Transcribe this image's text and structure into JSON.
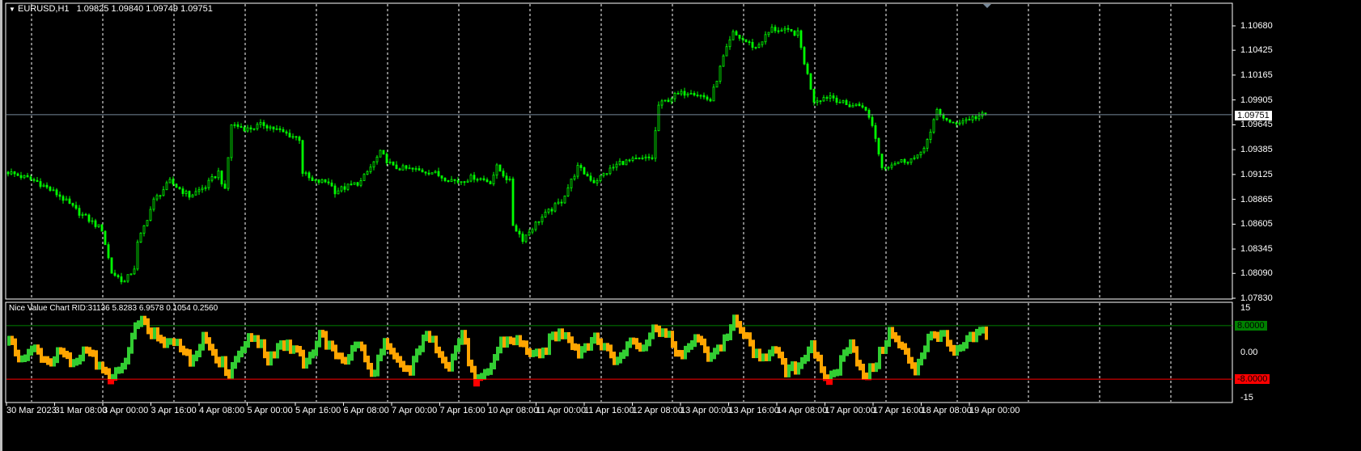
{
  "header": {
    "symbol": "EURUSD,H1",
    "ohlc": "1.09825 1.09840 1.09749 1.09751"
  },
  "indicator": {
    "label": "Nice Value Chart RID:31136 5.8283 6.9578 0.1054 0.2560",
    "axis": [
      "15",
      "0.00",
      "-15"
    ],
    "upper_level": "8.0000",
    "lower_level": "-8.0000",
    "upper_value": 8,
    "lower_value": -8,
    "range": [
      -15,
      15
    ],
    "values": [
      3,
      -2,
      1,
      -3,
      0,
      -4,
      2,
      -5,
      -8,
      -3,
      10,
      6,
      2,
      4,
      -3,
      5,
      -1,
      -6,
      2,
      5,
      -2,
      3,
      1,
      -4,
      6,
      0,
      -2,
      3,
      -7,
      2,
      -3,
      -6,
      5,
      2,
      -4,
      6,
      -10,
      -6,
      3,
      4,
      1,
      -2,
      5,
      6,
      0,
      4,
      2,
      -3,
      4,
      2,
      8,
      4,
      -2,
      5,
      -1,
      2,
      9,
      4,
      -3,
      2,
      -6,
      -4,
      3,
      -9,
      -5,
      4,
      -8,
      -3,
      6,
      1,
      -5,
      4,
      6,
      -1,
      3,
      6
    ]
  },
  "price_axis": [
    "1.10680",
    "1.10425",
    "1.10165",
    "1.09905",
    "1.09645",
    "1.09385",
    "1.09125",
    "1.08865",
    "1.08605",
    "1.08345",
    "1.08090",
    "1.07830"
  ],
  "current_price": "1.09751",
  "price_range": [
    1.0783,
    1.1068
  ],
  "time_axis": [
    "30 Mar 2023",
    "31 Mar 08:00",
    "3 Apr 00:00",
    "3 Apr 16:00",
    "4 Apr 08:00",
    "5 Apr 00:00",
    "5 Apr 16:00",
    "6 Apr 08:00",
    "7 Apr 00:00",
    "7 Apr 16:00",
    "10 Apr 08:00",
    "11 Apr 00:00",
    "11 Apr 16:00",
    "12 Apr 08:00",
    "13 Apr 00:00",
    "13 Apr 16:00",
    "14 Apr 08:00",
    "17 Apr 00:00",
    "17 Apr 16:00",
    "18 Apr 08:00",
    "19 Apr 00:00"
  ],
  "price_anchors": [
    [
      0,
      1.0915
    ],
    [
      9,
      1.0905
    ],
    [
      16,
      1.089
    ],
    [
      21,
      1.0875
    ],
    [
      29,
      1.0855
    ],
    [
      32,
      1.081
    ],
    [
      36,
      1.08
    ],
    [
      39,
      1.0815
    ],
    [
      40,
      1.084
    ],
    [
      45,
      1.0885
    ],
    [
      50,
      1.0905
    ],
    [
      56,
      1.089
    ],
    [
      61,
      1.09
    ],
    [
      65,
      1.0915
    ],
    [
      67,
      1.0895
    ],
    [
      69,
      1.0965
    ],
    [
      74,
      1.096
    ],
    [
      79,
      1.0965
    ],
    [
      86,
      1.0955
    ],
    [
      90,
      1.095
    ],
    [
      91,
      1.0915
    ],
    [
      94,
      1.0905
    ],
    [
      99,
      1.0905
    ],
    [
      101,
      1.0895
    ],
    [
      109,
      1.0905
    ],
    [
      115,
      1.0935
    ],
    [
      119,
      1.092
    ],
    [
      131,
      1.0915
    ],
    [
      134,
      1.091
    ],
    [
      139,
      1.0905
    ],
    [
      144,
      1.091
    ],
    [
      149,
      1.0905
    ],
    [
      151,
      1.092
    ],
    [
      155,
      1.0905
    ],
    [
      156,
      1.086
    ],
    [
      159,
      1.0845
    ],
    [
      164,
      1.0865
    ],
    [
      171,
      1.0885
    ],
    [
      176,
      1.092
    ],
    [
      181,
      1.0905
    ],
    [
      189,
      1.0925
    ],
    [
      199,
      1.093
    ],
    [
      201,
      1.0985
    ],
    [
      206,
      1.0995
    ],
    [
      211,
      1.1
    ],
    [
      217,
      1.099
    ],
    [
      221,
      1.1035
    ],
    [
      224,
      1.106
    ],
    [
      231,
      1.1045
    ],
    [
      236,
      1.1065
    ],
    [
      244,
      1.106
    ],
    [
      246,
      1.103
    ],
    [
      249,
      1.099
    ],
    [
      254,
      1.0995
    ],
    [
      259,
      1.0985
    ],
    [
      264,
      1.0985
    ],
    [
      267,
      1.0965
    ],
    [
      270,
      1.092
    ],
    [
      274,
      1.0925
    ],
    [
      281,
      1.093
    ],
    [
      285,
      1.0955
    ],
    [
      287,
      1.098
    ],
    [
      291,
      1.0965
    ],
    [
      296,
      1.097
    ],
    [
      302,
      1.09751
    ]
  ],
  "colors": {
    "candle": "#00ff00",
    "grid": "#ffffff",
    "current_line": "#778899",
    "up": "#32cd32",
    "down": "#ffa500",
    "extreme": "#ff0000",
    "upper_level": "#008000",
    "lower_level": "#ff0000"
  }
}
